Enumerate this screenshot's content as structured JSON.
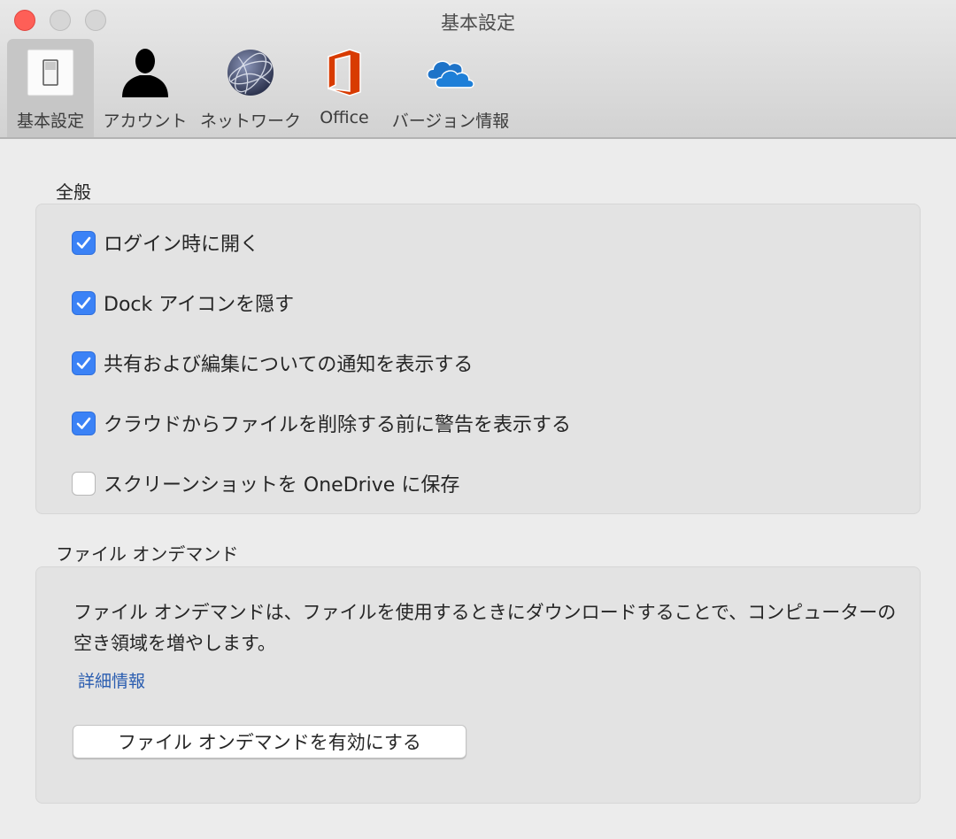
{
  "window": {
    "title": "基本設定",
    "controls": [
      "close",
      "minimize",
      "maximize"
    ]
  },
  "toolbar": {
    "items": [
      {
        "label": "基本設定",
        "icon": "light-switch-icon",
        "selected": true
      },
      {
        "label": "アカウント",
        "icon": "person-silhouette-icon",
        "selected": false
      },
      {
        "label": "ネットワーク",
        "icon": "network-globe-icon",
        "selected": false
      },
      {
        "label": "Office",
        "icon": "office-logo-icon",
        "selected": false
      },
      {
        "label": "バージョン情報",
        "icon": "onedrive-cloud-icon",
        "selected": false
      }
    ]
  },
  "general": {
    "title": "全般",
    "options": [
      {
        "label": "ログイン時に開く",
        "checked": true
      },
      {
        "label": "Dock アイコンを隠す",
        "checked": true
      },
      {
        "label": "共有および編集についての通知を表示する",
        "checked": true
      },
      {
        "label": "クラウドからファイルを削除する前に警告を表示する",
        "checked": true
      },
      {
        "label": "スクリーンショットを OneDrive に保存",
        "checked": false
      }
    ]
  },
  "files_on_demand": {
    "title": "ファイル オンデマンド",
    "description": "ファイル オンデマンドは、ファイルを使用するときにダウンロードすることで、コンピューターの空き領域を増やします。",
    "link_label": "詳細情報",
    "button_label": "ファイル オンデマンドを有効にする"
  },
  "colors": {
    "accent": "#3b82f6",
    "link": "#2a5db0",
    "close_button": "#fe5f57"
  }
}
